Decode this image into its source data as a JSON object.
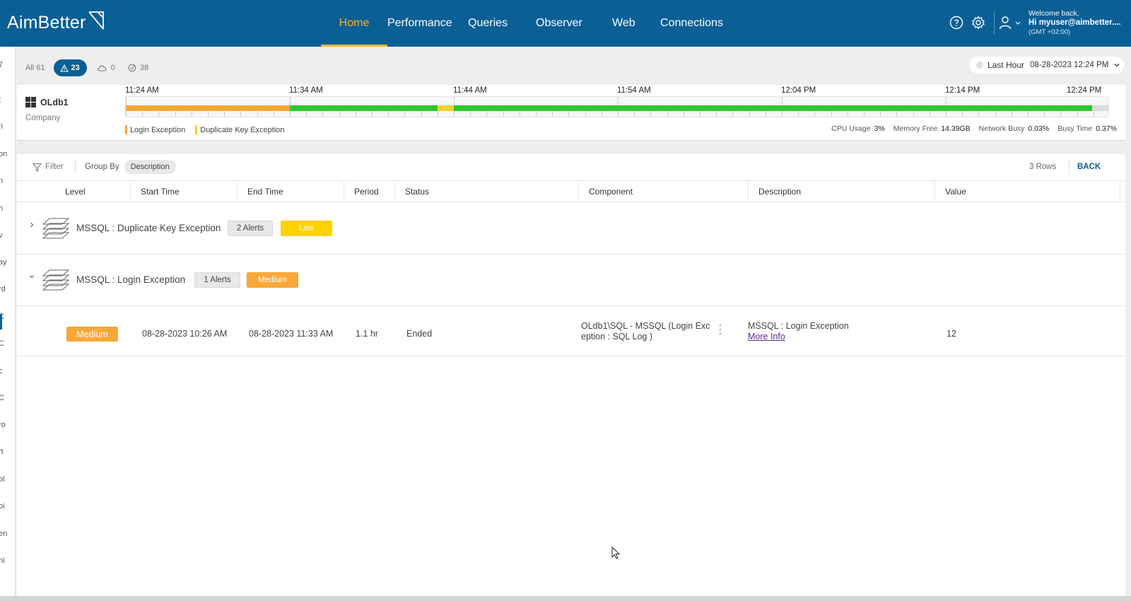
{
  "app": {
    "logo_text": "AimBetter"
  },
  "nav": {
    "items": [
      "Home",
      "Performance",
      "Queries",
      "Observer",
      "Web",
      "Connections"
    ],
    "active": "Home"
  },
  "user": {
    "welcome": "Welcome back,",
    "greeting": "Hi myuser@aimbetter....",
    "timezone": "(GMT +02:00)"
  },
  "sidebar_fragments": [
    "7",
    "t",
    "ri",
    "on",
    "n",
    "h",
    "v",
    "ay",
    "rd",
    "C",
    "C",
    "c",
    "C",
    "ro",
    "rt",
    "ol",
    "oi",
    "en",
    "ni"
  ],
  "counts": {
    "all": "All 61",
    "alerts": "23",
    "cloud": "0",
    "resolved": "38"
  },
  "time_selector": {
    "range": "Last Hour",
    "datetime": "08-28-2023 12:24 PM"
  },
  "server": {
    "name": "OLdb1",
    "subtitle": "Company",
    "time_labels": [
      "11:24 AM",
      "11:34 AM",
      "11:44 AM",
      "11:54 AM",
      "12:04 PM",
      "12:14 PM",
      "12:24 PM"
    ],
    "legend": [
      {
        "label": "Login Exception",
        "color": "#f8a838"
      },
      {
        "label": "Duplicate Key Exception",
        "color": "#f7d22a"
      }
    ],
    "stats": [
      {
        "label": "CPU Usage",
        "value": "3%"
      },
      {
        "label": "Memory Free",
        "value": "14.39GB"
      },
      {
        "label": "Network Busy",
        "value": "0.03%"
      },
      {
        "label": "Busy Time",
        "value": "0.37%"
      }
    ]
  },
  "toolbar": {
    "filter_label": "Filter",
    "group_by_label": "Group By",
    "group_by_value": "Description",
    "rows_label": "3 Rows",
    "back_label": "BACK"
  },
  "table": {
    "columns": [
      "Level",
      "Start Time",
      "End Time",
      "Period",
      "Status",
      "Component",
      "Description",
      "Value"
    ],
    "groups": [
      {
        "title": "MSSQL : Duplicate Key Exception",
        "count": "2 Alerts",
        "severity": "Low",
        "severity_color": "#ffd200",
        "expanded": false
      },
      {
        "title": "MSSQL : Login Exception",
        "count": "1 Alerts",
        "severity": "Medium",
        "severity_color": "#f8a838",
        "expanded": true
      }
    ],
    "rows": [
      {
        "level": "Medium",
        "start_time": "08-28-2023 10:26 AM",
        "end_time": "08-28-2023 11:33 AM",
        "period": "1.1 hr",
        "status": "Ended",
        "component": "OLdb1\\SQL - MSSQL (Login Exception : SQL Log )",
        "description": "MSSQL : Login Exception",
        "more_info": "More Info",
        "value": "12"
      }
    ]
  },
  "colors": {
    "header_bg": "#0a5f95",
    "active_nav": "#f8b62b",
    "low": "#ffd200",
    "medium": "#f8a838",
    "ok_green": "#2ec730"
  }
}
